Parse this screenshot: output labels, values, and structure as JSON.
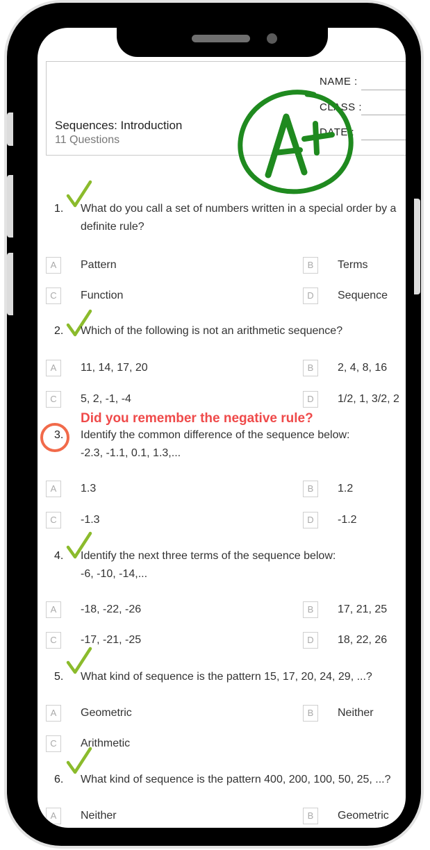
{
  "worksheet": {
    "title": "Sequences: Introduction",
    "subtitle": "11 Questions",
    "fields": [
      "NAME :",
      "CLASS :",
      "DATE :"
    ]
  },
  "grade": {
    "text": "A+",
    "color": "#1f8a1f"
  },
  "annotation": {
    "text": "Did you remember the negative rule?",
    "color": "#ef4a4a"
  },
  "check_color": "#8bbb2c",
  "questions": [
    {
      "number": "1.",
      "text": [
        "What do you call a set of numbers written in a special order by a",
        "definite rule?"
      ],
      "options": [
        {
          "letter": "A",
          "text": "Pattern"
        },
        {
          "letter": "B",
          "text": "Terms"
        },
        {
          "letter": "C",
          "text": "Function"
        },
        {
          "letter": "D",
          "text": "Sequence"
        }
      ]
    },
    {
      "number": "2.",
      "text": [
        "Which of the following is not an arithmetic sequence?"
      ],
      "options": [
        {
          "letter": "A",
          "text": "11, 14, 17, 20"
        },
        {
          "letter": "B",
          "text": "2, 4, 8, 16"
        },
        {
          "letter": "C",
          "text": "5, 2, -1, -4"
        },
        {
          "letter": "D",
          "text": "1/2, 1, 3/2, 2"
        }
      ]
    },
    {
      "number": "3.",
      "text": [
        "Identify the common difference of the sequence below:",
        "-2.3, -1.1, 0.1, 1.3,..."
      ],
      "options": [
        {
          "letter": "A",
          "text": "1.3"
        },
        {
          "letter": "B",
          "text": "1.2"
        },
        {
          "letter": "C",
          "text": "-1.3"
        },
        {
          "letter": "D",
          "text": "-1.2"
        }
      ]
    },
    {
      "number": "4.",
      "text": [
        "Identify the next three terms of the sequence below:",
        "-6, -10, -14,..."
      ],
      "options": [
        {
          "letter": "A",
          "text": "-18, -22, -26"
        },
        {
          "letter": "B",
          "text": "17, 21, 25"
        },
        {
          "letter": "C",
          "text": "-17, -21, -25"
        },
        {
          "letter": "D",
          "text": "18, 22, 26"
        }
      ]
    },
    {
      "number": "5.",
      "text": [
        "What kind of sequence is the pattern 15, 17, 20, 24, 29, ...?"
      ],
      "options": [
        {
          "letter": "A",
          "text": "Geometric"
        },
        {
          "letter": "B",
          "text": "Neither"
        },
        {
          "letter": "C",
          "text": "Arithmetic"
        }
      ]
    },
    {
      "number": "6.",
      "text": [
        "What kind of sequence is the pattern 400, 200, 100, 50, 25, ...?"
      ],
      "options": [
        {
          "letter": "A",
          "text": "Neither"
        },
        {
          "letter": "B",
          "text": "Geometric"
        }
      ]
    }
  ]
}
